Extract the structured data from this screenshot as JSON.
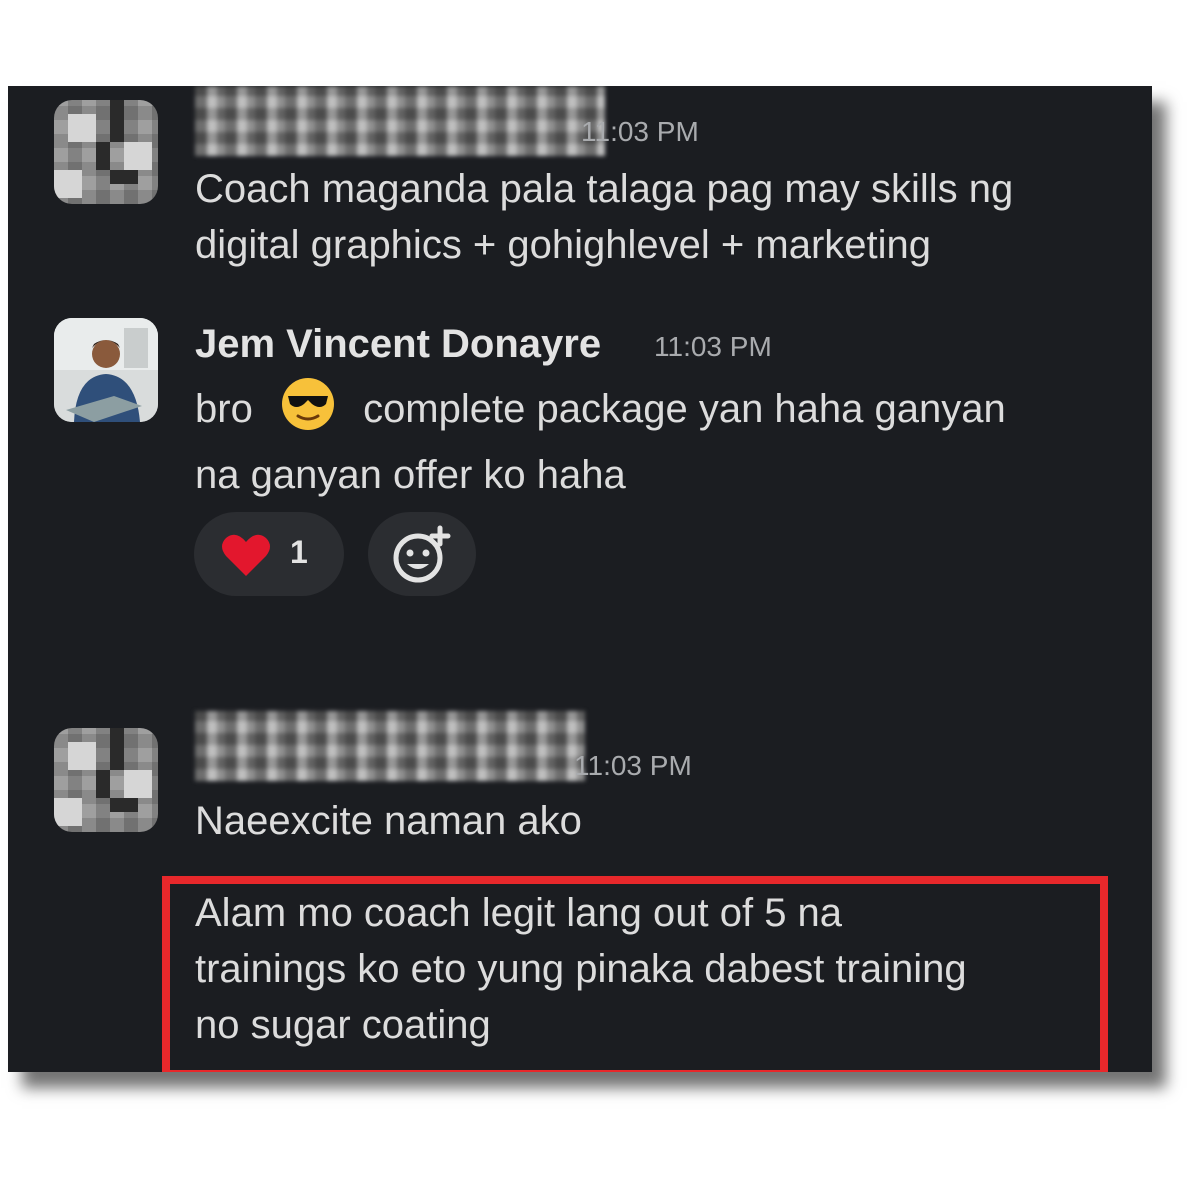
{
  "messages": [
    {
      "time": "11:03 PM",
      "lines": [
        "Coach maganda pala talaga pag may skills ng",
        "digital graphics + gohighlevel + marketing"
      ]
    },
    {
      "sender": "Jem Vincent Donayre",
      "time": "11:03 PM",
      "lines": [
        "bro",
        "complete package yan haha ganyan",
        "na ganyan offer ko haha"
      ],
      "reactions": [
        {
          "emoji": "heart-icon",
          "count": "1"
        }
      ]
    },
    {
      "time": "11:03 PM",
      "lines": [
        "Naeexcite naman ako"
      ],
      "followup": [
        "Alam mo coach legit lang out of 5 na",
        "trainings ko eto yung pinaka dabest training",
        "no sugar coating"
      ]
    }
  ],
  "colors": {
    "background": "#1b1d21",
    "highlight": "#e8282b",
    "reaction_bg": "#2b2d31"
  }
}
